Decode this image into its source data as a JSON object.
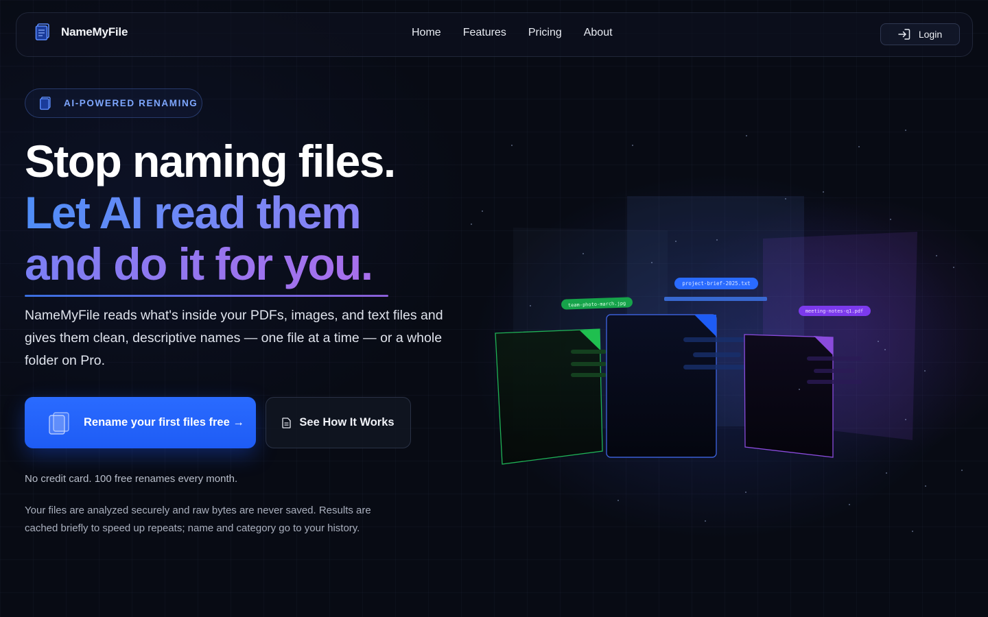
{
  "brand": {
    "name": "NameMyFile",
    "icon": "file-stack-icon"
  },
  "nav": {
    "links": [
      "Home",
      "Features",
      "Pricing",
      "About"
    ],
    "login_label": "Login",
    "login_icon": "login-arrow-icon"
  },
  "hero": {
    "badge": "AI-POWERED RENAMING",
    "headline_line1": "Stop naming files.",
    "headline_line2": "Let AI read them",
    "headline_line3": "and do it for you.",
    "subtext": "NameMyFile reads what's inside your PDFs, images, and text files and gives them clean, descriptive names — one file at a time — or a whole folder on Pro.",
    "primary_cta": "Rename your first files free →",
    "secondary_cta": "See How It Works",
    "note_free": "No credit card. 100 free renames every month.",
    "note_privacy": "Your files are analyzed securely and raw bytes are never saved. Results are cached briefly to speed up repeats; name and category go to your history."
  },
  "illustration": {
    "file_labels": [
      "team-photo-march.jpg",
      "project-brief-2025.txt",
      "meeting-notes-q1.pdf"
    ],
    "colors": {
      "green": "#1fbf4f",
      "blue": "#2a6bff",
      "purple": "#8a4bdc"
    }
  },
  "colors": {
    "background": "#080b14",
    "accent_blue": "#2a6bff",
    "accent_purple": "#9a74ee",
    "badge_text": "#7ea7ff"
  }
}
